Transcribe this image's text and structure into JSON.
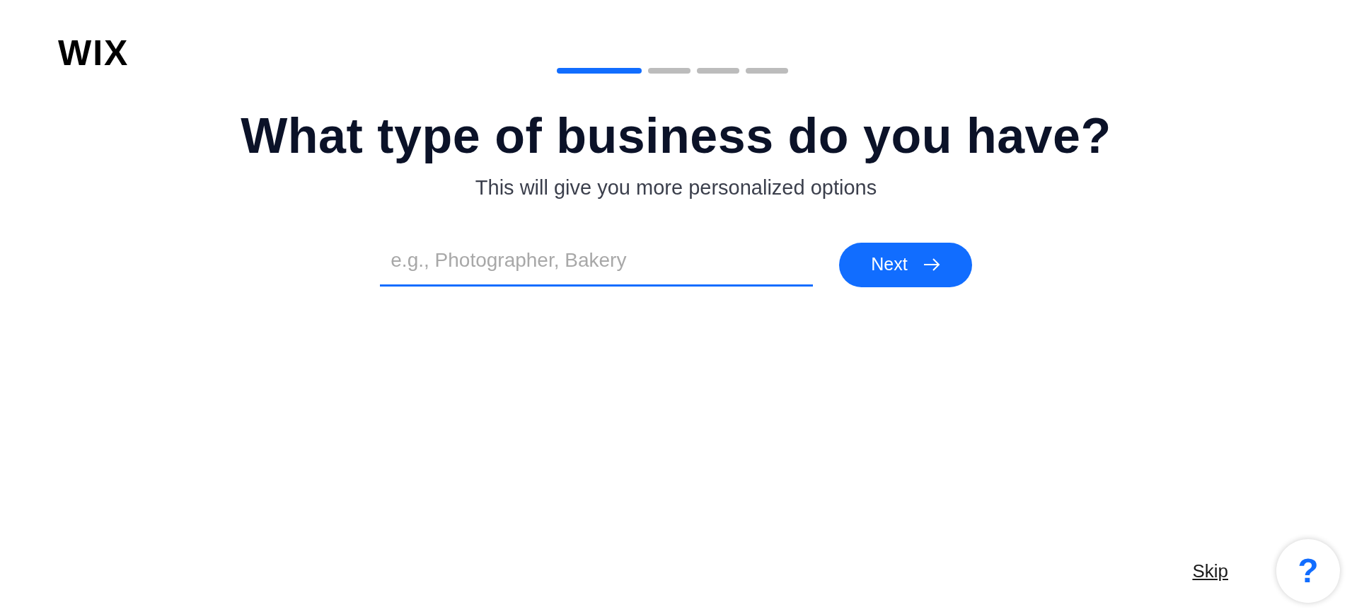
{
  "logo": {
    "text": "WIX"
  },
  "progress": [
    {
      "selected": true
    },
    {
      "selected": false
    },
    {
      "selected": false
    },
    {
      "selected": false
    }
  ],
  "heading": "What type of business do you have?",
  "subtitle": "This will give you more personalized options",
  "business_field": {
    "placeholder": "e.g., Photographer, Bakery"
  },
  "next_button": {
    "label": "Next"
  },
  "skip_link": "Skip",
  "help_button": {
    "label": "?"
  }
}
